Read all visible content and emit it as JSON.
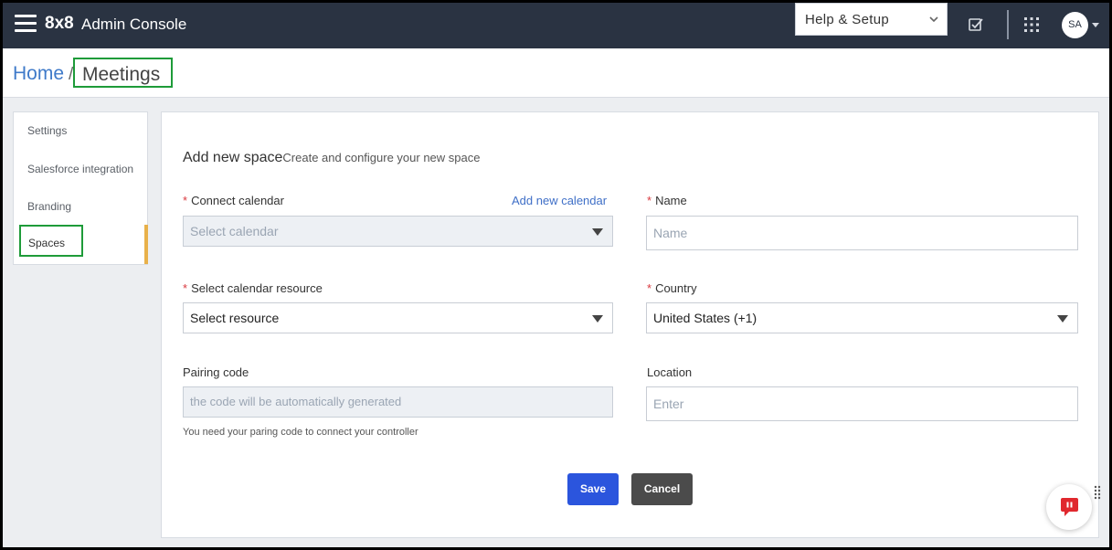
{
  "topbar": {
    "brand_logo": "8x8",
    "brand_title": "Admin Console",
    "help_label": "Help & Setup",
    "avatar_initials": "SA"
  },
  "breadcrumb": {
    "home": "Home",
    "separator": "/",
    "current": "Meetings"
  },
  "sidebar": {
    "items": [
      {
        "label": "Settings"
      },
      {
        "label": "Salesforce integration"
      },
      {
        "label": "Branding"
      },
      {
        "label": "Spaces",
        "active": true
      }
    ]
  },
  "form": {
    "title": "Add new space",
    "subtitle": "Create and configure your new space",
    "connect_calendar": {
      "label": "Connect calendar",
      "required_mark": "*",
      "link": "Add new calendar",
      "placeholder": "Select calendar"
    },
    "name": {
      "label": "Name",
      "required_mark": "*",
      "placeholder": "Name"
    },
    "calendar_resource": {
      "label": "Select calendar resource",
      "required_mark": "*",
      "value": "Select resource"
    },
    "country": {
      "label": "Country",
      "required_mark": "*",
      "value": "United States (+1)"
    },
    "pairing_code": {
      "label": "Pairing code",
      "placeholder": "the code will be automatically generated",
      "hint": "You need your paring code to connect your controller"
    },
    "location": {
      "label": "Location",
      "placeholder": "Enter"
    },
    "save_label": "Save",
    "cancel_label": "Cancel"
  },
  "icons": {
    "menu": "hamburger-menu-icon",
    "help_chevron": "chevron-down-icon",
    "tasks": "checkbox-task-icon",
    "apps": "apps-grid-icon",
    "avatar_caret": "caret-down-icon",
    "select_caret": "caret-down-icon",
    "chat": "chat-bubble-icon",
    "drag": "drag-handle-icon"
  },
  "colors": {
    "topbar_bg": "#2a3342",
    "link_blue": "#3f6fc7",
    "save_button": "#2b55dd",
    "cancel_button": "#4b4b4b",
    "required_red": "#d9393f",
    "active_nav_bar": "#e8b14a",
    "highlight_box": "#1e9b39",
    "chat_red": "#e0282e"
  }
}
